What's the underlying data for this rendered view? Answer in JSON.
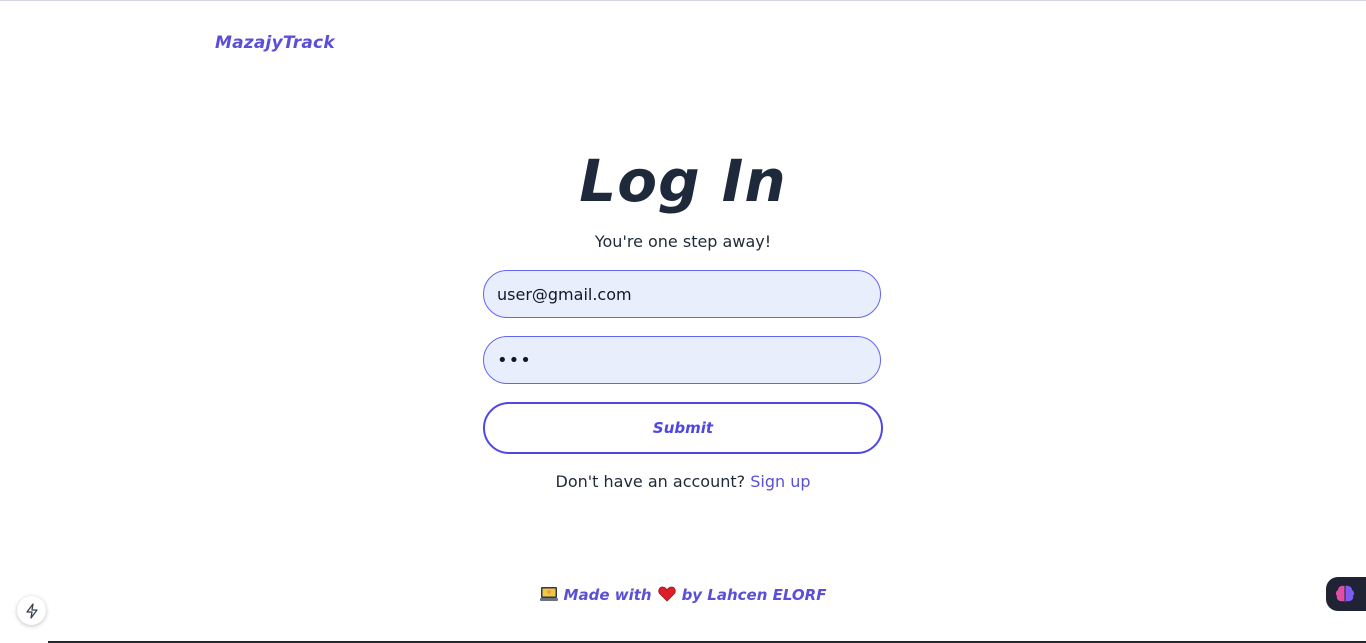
{
  "header": {
    "brand": "MazajyTrack"
  },
  "login": {
    "title": "Log In",
    "subtitle": "You're one step away!",
    "email_value": "user@gmail.com",
    "password_value": "•••",
    "submit_label": "Submit",
    "signup_prompt": "Don't have an account?",
    "signup_link": "Sign up"
  },
  "footer": {
    "made_with": "Made with",
    "by_text": "by Lahcen ELORF"
  },
  "icons": {
    "laptop": "laptop-icon",
    "heart": "heart-icon",
    "bolt": "lightning-bolt-icon",
    "brain": "brain-icon"
  },
  "colors": {
    "accent": "#5b4fd8",
    "button_border": "#4f46e5",
    "input_bg": "#e8eefc",
    "heading": "#1e293b"
  }
}
